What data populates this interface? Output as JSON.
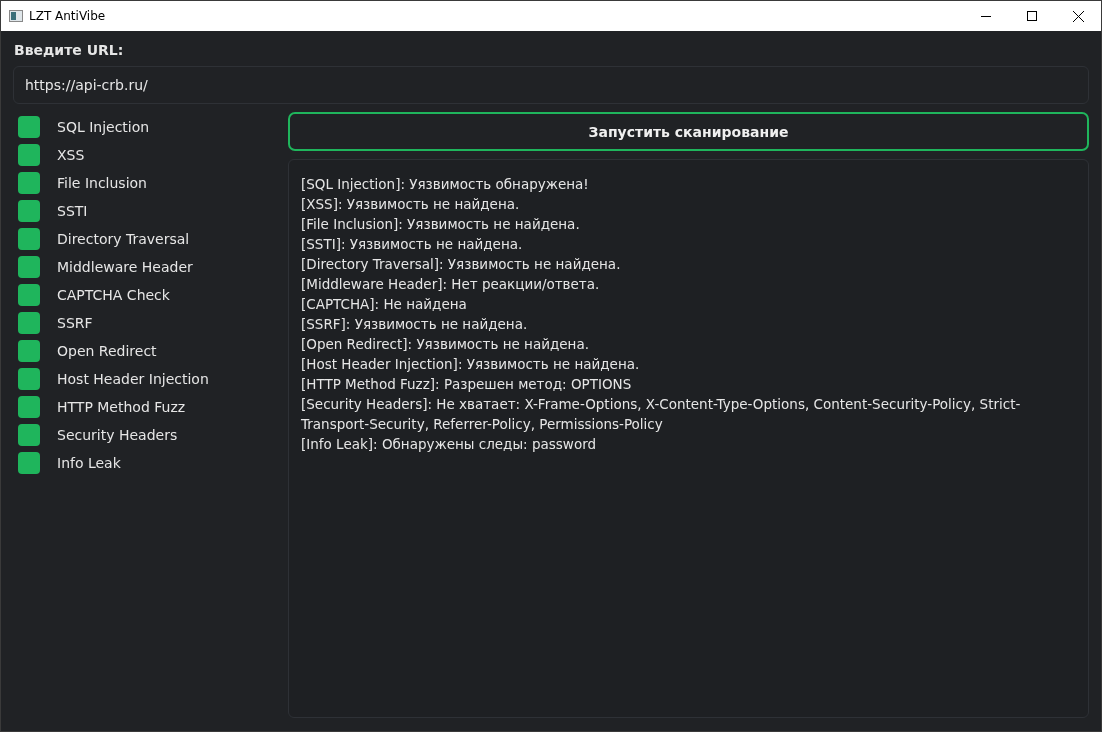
{
  "window": {
    "title": "LZT AntiVibe"
  },
  "url_label": "Введите URL:",
  "url_field": {
    "value": "https://api-crb.ru/"
  },
  "checks": [
    {
      "label": "SQL Injection",
      "checked": true
    },
    {
      "label": "XSS",
      "checked": true
    },
    {
      "label": "File Inclusion",
      "checked": true
    },
    {
      "label": "SSTI",
      "checked": true
    },
    {
      "label": "Directory Traversal",
      "checked": true
    },
    {
      "label": "Middleware Header",
      "checked": true
    },
    {
      "label": "CAPTCHA Check",
      "checked": true
    },
    {
      "label": "SSRF",
      "checked": true
    },
    {
      "label": "Open Redirect",
      "checked": true
    },
    {
      "label": "Host Header Injection",
      "checked": true
    },
    {
      "label": "HTTP Method Fuzz",
      "checked": true
    },
    {
      "label": "Security Headers",
      "checked": true
    },
    {
      "label": "Info Leak",
      "checked": true
    }
  ],
  "scan_button": "Запустить сканирование",
  "log": [
    "[SQL Injection]: Уязвимость обнаружена!",
    "[XSS]: Уязвимость не найдена.",
    "[File Inclusion]: Уязвимость не найдена.",
    "[SSTI]: Уязвимость не найдена.",
    "[Directory Traversal]: Уязвимость не найдена.",
    "[Middleware Header]: Нет реакции/ответа.",
    "[CAPTCHA]: Не найдена",
    "[SSRF]: Уязвимость не найдена.",
    "[Open Redirect]: Уязвимость не найдена.",
    "[Host Header Injection]: Уязвимость не найдена.",
    "[HTTP Method Fuzz]: Разрешен метод: OPTIONS",
    "[Security Headers]: Не хватает: X-Frame-Options, X-Content-Type-Options, Content-Security-Policy, Strict-Transport-Security, Referrer-Policy, Permissions-Policy",
    "[Info Leak]: Обнаружены следы: password"
  ]
}
